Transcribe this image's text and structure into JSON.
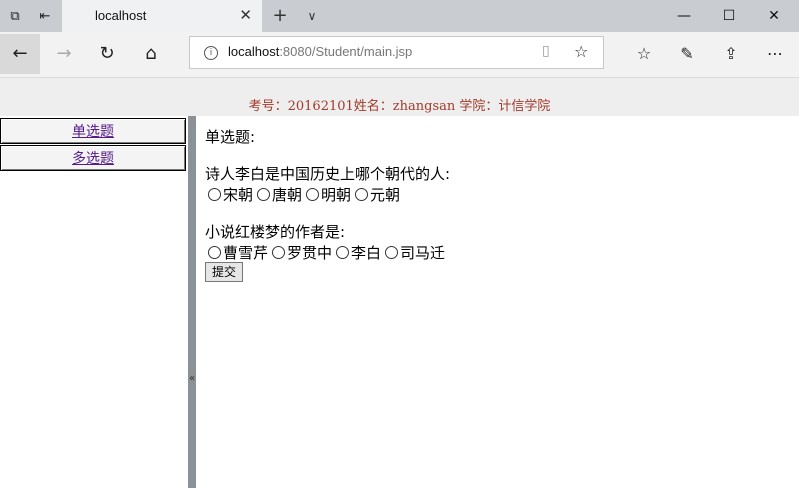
{
  "browser": {
    "tab_title": "localhost",
    "address": {
      "host": "localhost",
      "rest": ":8080/Student/main.jsp"
    },
    "window_controls": {
      "minimize": "—",
      "maximize": "☐",
      "close": "✕"
    }
  },
  "page": {
    "header": "考号：20162101姓名：zhangsan 学院：计信学院",
    "sidebar": {
      "items": [
        {
          "label": "单选题"
        },
        {
          "label": "多选题"
        }
      ],
      "splitter_glyph": "«"
    },
    "main": {
      "section_title": "单选题:",
      "questions": [
        {
          "text": "诗人李白是中国历史上哪个朝代的人:",
          "options": [
            "宋朝",
            "唐朝",
            "明朝",
            "元朝"
          ]
        },
        {
          "text": "小说红楼梦的作者是:",
          "options": [
            "曹雪芹",
            "罗贯中",
            "李白",
            "司马迁"
          ]
        }
      ],
      "submit_label": "提交"
    }
  }
}
